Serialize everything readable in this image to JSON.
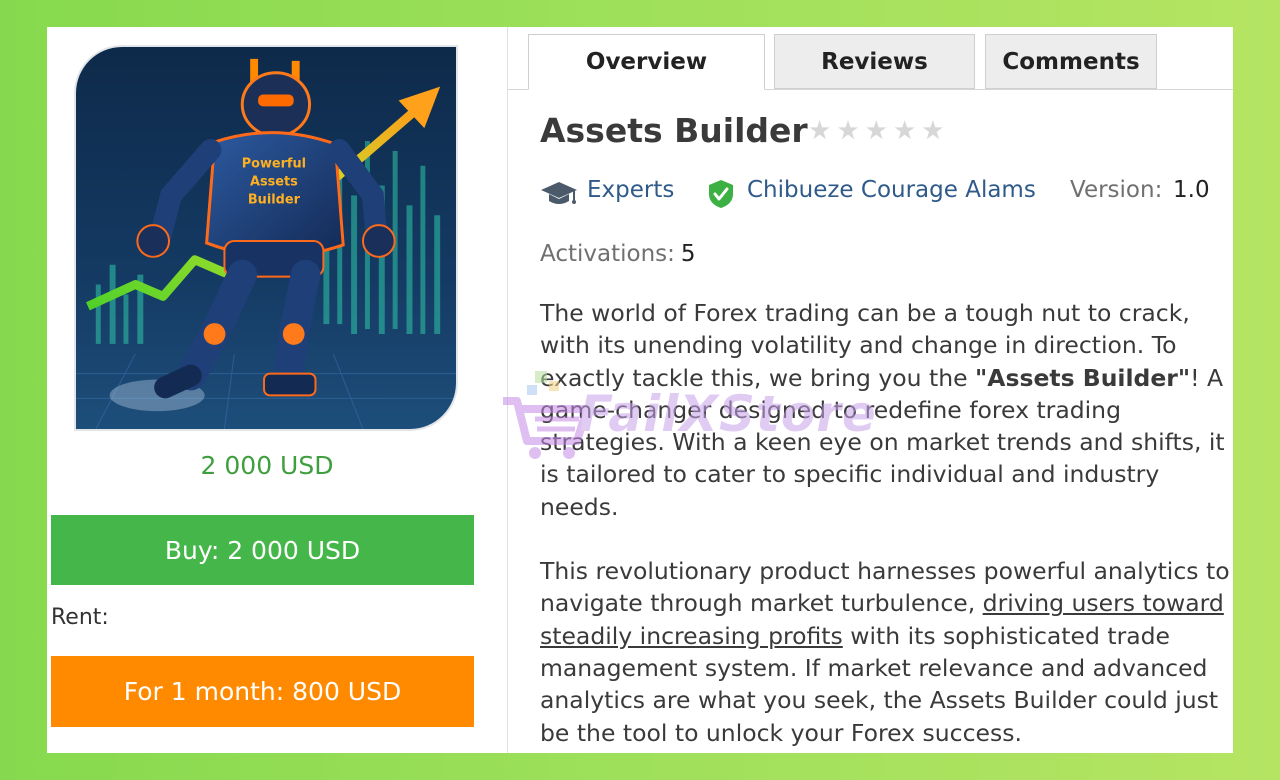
{
  "tabs": [
    {
      "label": "Overview",
      "active": true
    },
    {
      "label": "Reviews",
      "active": false
    },
    {
      "label": "Comments",
      "active": false
    }
  ],
  "product": {
    "image_text": "Powerful Assets Builder",
    "title": "Assets Builder",
    "rating_stars_filled": 0,
    "rating_stars_total": 5,
    "category": "Experts",
    "category_icon": "graduation-cap-icon",
    "author": "Chibueze Courage Alams",
    "author_icon": "verified-shield-icon",
    "version_label": "Version:",
    "version_value": "1.0",
    "activations_label": "Activations:",
    "activations_value": "5"
  },
  "pricing": {
    "price": "2 000 USD",
    "buy_label": "Buy: 2 000 USD",
    "rent_label": "Rent:",
    "rent_option_label": "For 1 month: 800 USD"
  },
  "description": {
    "p1_before": "The world of Forex trading can be a tough nut to crack, with its unending volatility and change in direction. To exactly tackle this, we bring you the ",
    "p1_bold": "\"Assets Builder\"",
    "p1_after": "! A game-changer designed to redefine forex trading strategies. With a keen eye on market trends and shifts, it is tailored to cater to specific individual and industry needs.",
    "p2_before": "This revolutionary product harnesses powerful analytics to navigate through market turbulence, ",
    "p2_link": "driving users toward steadily increasing profits",
    "p2_after": " with its sophisticated trade management system. If market relevance and advanced analytics are what you seek, the Assets Builder could just be the tool to unlock your Forex success."
  },
  "watermark": {
    "text": "FailXStore"
  },
  "colors": {
    "price_green": "#3f9f3f",
    "buy_green": "#45b649",
    "rent_orange": "#ff8a00",
    "link_blue": "#2f5a8a",
    "verified_green": "#3cb043",
    "background_green": "#9fe05a"
  }
}
